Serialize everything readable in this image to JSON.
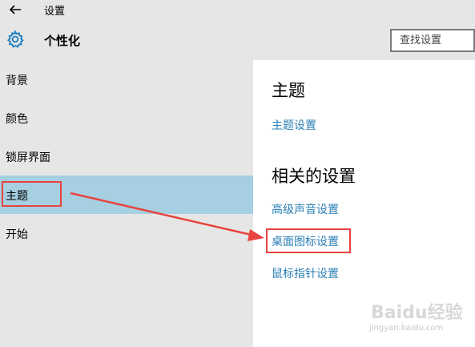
{
  "window": {
    "title": "设置"
  },
  "header": {
    "title": "个性化",
    "search_placeholder": "查找设置"
  },
  "sidebar": {
    "items": [
      {
        "label": "背景"
      },
      {
        "label": "颜色"
      },
      {
        "label": "锁屏界面"
      },
      {
        "label": "主题"
      },
      {
        "label": "开始"
      }
    ],
    "selected": "主题"
  },
  "main": {
    "theme_heading": "主题",
    "theme_settings_link": "主题设置",
    "related_heading": "相关的设置",
    "related_links": [
      {
        "label": "高级声音设置"
      },
      {
        "label": "桌面图标设置"
      },
      {
        "label": "鼠标指针设置"
      }
    ]
  },
  "watermark": {
    "logo": "Baidu经验",
    "url": "jingyan.baidu.com"
  },
  "colors": {
    "chrome_background": "#e6e6e6",
    "selected_item": "#a6cfe1",
    "link": "#2a7fb5",
    "annotation_red": "#e8433e"
  },
  "icons": [
    "back-arrow-icon",
    "gear-icon"
  ]
}
